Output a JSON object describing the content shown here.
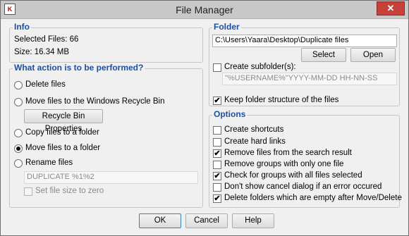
{
  "window": {
    "title": "File Manager",
    "app_icon_text": "K",
    "close_symbol": "✕"
  },
  "info": {
    "title": "Info",
    "selected_files": "Selected Files: 66",
    "size": "Size: 16.34 MB"
  },
  "action": {
    "title": "What action is to be performed?",
    "delete": "Delete files",
    "recycle": "Move files to the Windows Recycle Bin",
    "recycle_props": "Recycle Bin Properties",
    "copy": "Copy files to a folder",
    "move": "Move files to a folder",
    "rename": "Rename files",
    "rename_pattern": "DUPLICATE %1%2",
    "set_size_zero": "Set file size to zero",
    "selected": "move"
  },
  "folder": {
    "title": "Folder",
    "path": "C:\\Users\\Yaara\\Desktop\\Duplicate files",
    "select": "Select",
    "open": "Open",
    "create_subfolder": "Create subfolder(s):",
    "subfolder_pattern": "\"%USERNAME%\"YYYY-MM-DD HH-NN-SS",
    "keep_structure": "Keep folder structure of the files"
  },
  "options": {
    "title": "Options",
    "items": [
      {
        "label": "Create shortcuts",
        "checked": false
      },
      {
        "label": "Create hard links",
        "checked": false
      },
      {
        "label": "Remove files from the search result",
        "checked": true
      },
      {
        "label": "Remove groups with only one file",
        "checked": false
      },
      {
        "label": "Check for groups with all files selected",
        "checked": true
      },
      {
        "label": "Don't show cancel dialog if an error occured",
        "checked": false
      },
      {
        "label": "Delete folders which are empty after Move/Delete",
        "checked": true
      }
    ]
  },
  "footer": {
    "ok": "OK",
    "cancel": "Cancel",
    "help": "Help"
  },
  "check_mark": "✔"
}
